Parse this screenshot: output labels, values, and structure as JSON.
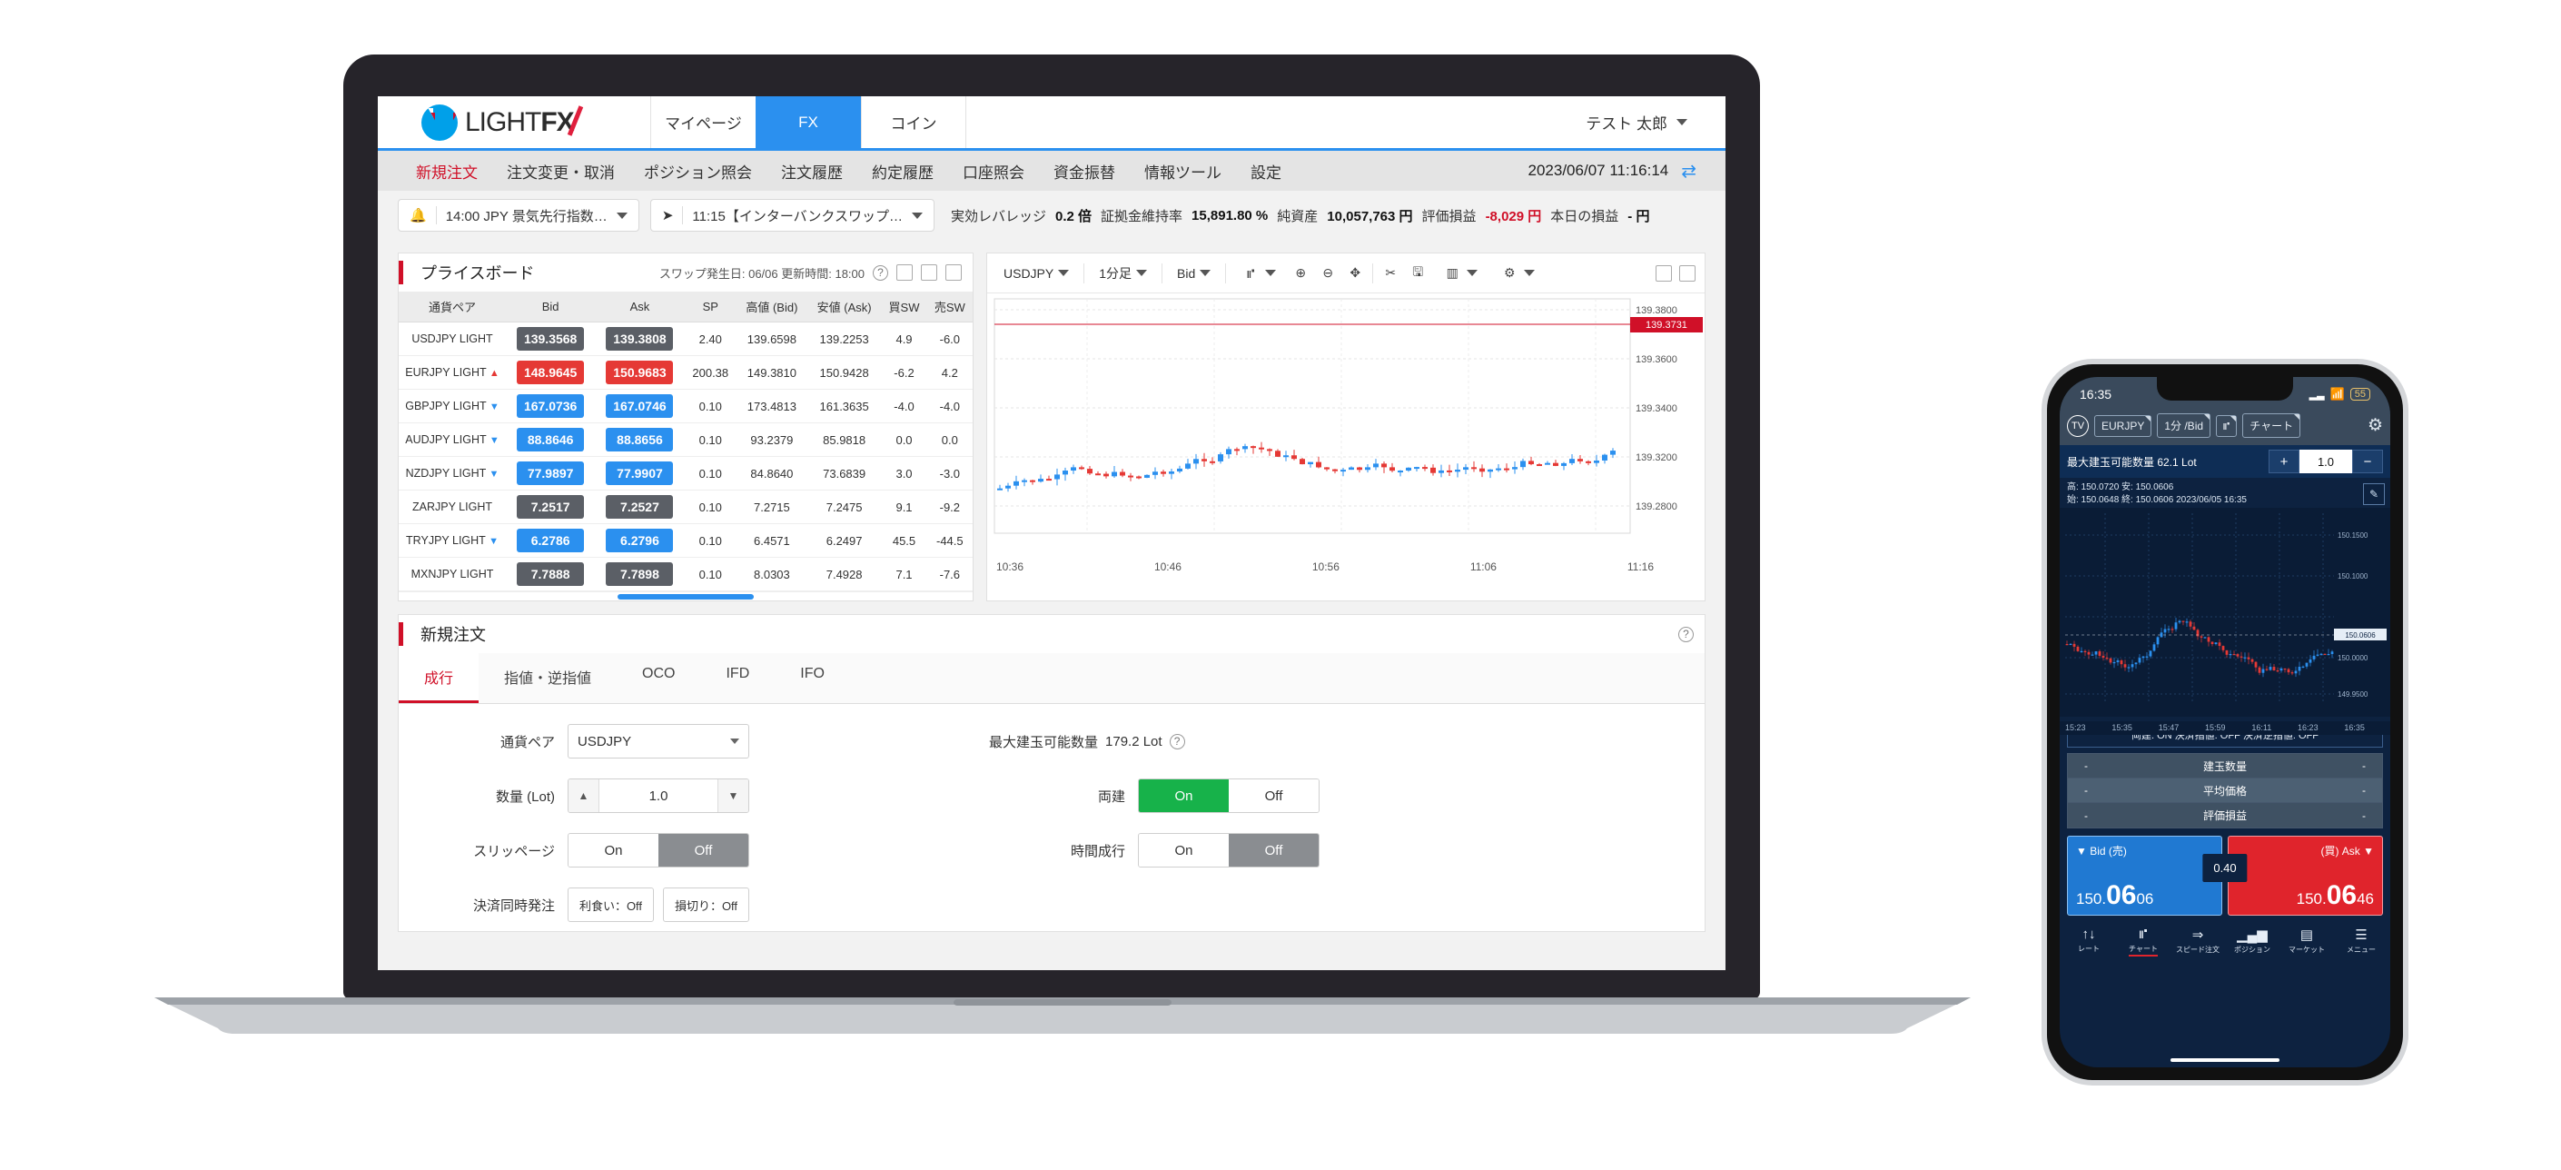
{
  "laptop": {
    "topnav": {
      "logo": "LIGHT FX",
      "tabs": [
        {
          "label": "マイページ",
          "active": false
        },
        {
          "label": "FX",
          "active": true
        },
        {
          "label": "コイン",
          "active": false
        }
      ],
      "user": "テスト 太郎"
    },
    "menubar": {
      "items": [
        {
          "label": "新規注文",
          "active": true
        },
        {
          "label": "注文変更・取消",
          "active": false
        },
        {
          "label": "ポジション照会",
          "active": false
        },
        {
          "label": "注文履歴",
          "active": false
        },
        {
          "label": "約定履歴",
          "active": false
        },
        {
          "label": "口座照会",
          "active": false
        },
        {
          "label": "資金振替",
          "active": false
        },
        {
          "label": "情報ツール",
          "active": false
        },
        {
          "label": "設定",
          "active": false
        }
      ],
      "datetime": "2023/06/07 11:16:14"
    },
    "infostrip": {
      "news1": "14:00 JPY 景気先行指数…",
      "news2": "11:15【インターバンクスワップ…",
      "metrics": [
        {
          "label": "実効レバレッジ",
          "value": "0.2 倍"
        },
        {
          "label": "証拠金維持率",
          "value": "15,891.80 %"
        },
        {
          "label": "純資産",
          "value": "10,057,763 円"
        },
        {
          "label": "評価損益",
          "value": "-8,029 円",
          "negative": true
        },
        {
          "label": "本日の損益",
          "value": "- 円"
        }
      ]
    },
    "priceboard": {
      "title": "プライスボード",
      "swap_note": "スワップ発生日: 06/06 更新時間: 18:00",
      "columns": [
        "通貨ペア",
        "Bid",
        "Ask",
        "SP",
        "高値 (Bid)",
        "安値 (Ask)",
        "買SW",
        "売SW"
      ],
      "rows": [
        {
          "pair": "USDJPY LIGHT",
          "dir": "",
          "bid": "139.3568",
          "ask": "139.3808",
          "sp": "2.40",
          "high": "139.6598",
          "low": "139.2253",
          "buysw": "4.9",
          "sellsw": "-6.0",
          "bidstyle": "grey",
          "askstyle": "grey"
        },
        {
          "pair": "EURJPY LIGHT",
          "dir": "up",
          "bid": "148.9645",
          "ask": "150.9683",
          "sp": "200.38",
          "high": "149.3810",
          "low": "150.9428",
          "buysw": "-6.2",
          "sellsw": "4.2",
          "bidstyle": "red",
          "askstyle": "red"
        },
        {
          "pair": "GBPJPY LIGHT",
          "dir": "down",
          "bid": "167.0736",
          "ask": "167.0746",
          "sp": "0.10",
          "high": "173.4813",
          "low": "161.3635",
          "buysw": "-4.0",
          "sellsw": "-4.0",
          "bidstyle": "blue",
          "askstyle": "blue"
        },
        {
          "pair": "AUDJPY LIGHT",
          "dir": "down",
          "bid": "88.8646",
          "ask": "88.8656",
          "sp": "0.10",
          "high": "93.2379",
          "low": "85.9818",
          "buysw": "0.0",
          "sellsw": "0.0",
          "bidstyle": "blue",
          "askstyle": "blue"
        },
        {
          "pair": "NZDJPY LIGHT",
          "dir": "down",
          "bid": "77.9897",
          "ask": "77.9907",
          "sp": "0.10",
          "high": "84.8640",
          "low": "73.6839",
          "buysw": "3.0",
          "sellsw": "-3.0",
          "bidstyle": "blue",
          "askstyle": "blue"
        },
        {
          "pair": "ZARJPY LIGHT",
          "dir": "",
          "bid": "7.2517",
          "ask": "7.2527",
          "sp": "0.10",
          "high": "7.2715",
          "low": "7.2475",
          "buysw": "9.1",
          "sellsw": "-9.2",
          "bidstyle": "grey",
          "askstyle": "grey"
        },
        {
          "pair": "TRYJPY LIGHT",
          "dir": "down",
          "bid": "6.2786",
          "ask": "6.2796",
          "sp": "0.10",
          "high": "6.4571",
          "low": "6.2497",
          "buysw": "45.5",
          "sellsw": "-44.5",
          "bidstyle": "blue",
          "askstyle": "blue"
        },
        {
          "pair": "MXNJPY LIGHT",
          "dir": "",
          "bid": "7.7888",
          "ask": "7.7898",
          "sp": "0.10",
          "high": "8.0303",
          "low": "7.4928",
          "buysw": "7.1",
          "sellsw": "-7.6",
          "bidstyle": "grey",
          "askstyle": "grey"
        }
      ]
    },
    "chart": {
      "symbol": "USDJPY",
      "timeframe": "1分足",
      "pricetype": "Bid",
      "current_price": "139.3731",
      "yticks": [
        "139.3800",
        "139.3600",
        "139.3400",
        "139.3200",
        "139.2800"
      ],
      "xticks": [
        "10:36",
        "10:46",
        "10:56",
        "11:06",
        "11:16"
      ]
    },
    "order": {
      "title": "新規注文",
      "tabs": [
        {
          "label": "成行",
          "active": true
        },
        {
          "label": "指値・逆指値",
          "active": false
        },
        {
          "label": "OCO",
          "active": false
        },
        {
          "label": "IFD",
          "active": false
        },
        {
          "label": "IFO",
          "active": false
        }
      ],
      "fields": {
        "pair_label": "通貨ペア",
        "pair_value": "USDJPY",
        "qty_label": "数量 (Lot)",
        "qty_value": "1.0",
        "slippage_label": "スリッページ",
        "slippage_on": "On",
        "slippage_off": "Off",
        "slippage_selected": "Off",
        "settle_label": "決済同時発注",
        "settle_tp": "利食い：Off",
        "settle_sl": "損切り：Off",
        "maxlot_label": "最大建玉可能数量",
        "maxlot_value": "179.2 Lot",
        "ryodate_label": "両建",
        "ryodate_on": "On",
        "ryodate_off": "Off",
        "ryodate_selected": "On",
        "timed_label": "時間成行",
        "timed_on": "On",
        "timed_off": "Off",
        "timed_selected": "Off"
      }
    }
  },
  "phone": {
    "status": {
      "time": "16:35",
      "battery": "55"
    },
    "toolbar": {
      "symbol": "EURJPY",
      "timeframe": "1分 /Bid",
      "chart_label": "チャート"
    },
    "qty": {
      "label": "最大建玉可能数量 62.1 Lot",
      "value": "1.0",
      "plus": "+",
      "minus": "−"
    },
    "ohlc_line1": "高: 150.0720  安: 150.0606",
    "ohlc_line2": "始: 150.0648  終: 150.0606  2023/06/05 16:35",
    "chart_yticks": [
      "150.1500",
      "150.1000",
      "150.0606",
      "150.0000",
      "149.9500"
    ],
    "chart_xticks": [
      "15:23",
      "15:35",
      "15:47",
      "15:59",
      "16:11",
      "16:23",
      "16:35"
    ],
    "flags": "両建: ON   決済指値: OFF   決済逆指値: OFF",
    "table": [
      {
        "left": "-",
        "center": "建玉数量",
        "right": "-"
      },
      {
        "left": "-",
        "center": "平均価格",
        "right": "-"
      },
      {
        "left": "-",
        "center": "評価損益",
        "right": "-"
      }
    ],
    "bid": {
      "caption": "▼ Bid (売)",
      "int": "150.",
      "big": "06",
      "dec": "06"
    },
    "ask": {
      "caption": "(買) Ask ▼",
      "int": "150.",
      "big": "06",
      "dec": "46"
    },
    "spread": "0.40",
    "tabs": [
      {
        "label": "レート",
        "icon": "↑↓",
        "active": false
      },
      {
        "label": "チャート",
        "icon": "⑈",
        "active": true
      },
      {
        "label": "スピード注文",
        "icon": "⇒",
        "active": false
      },
      {
        "label": "ポジション",
        "icon": "⑉",
        "active": false
      },
      {
        "label": "マーケット",
        "icon": "▤",
        "active": false
      },
      {
        "label": "メニュー",
        "icon": "☰",
        "active": false
      }
    ]
  },
  "colors": {
    "brand_blue": "#2b90ef",
    "accent_red": "#d01028",
    "green": "#17b24a"
  }
}
